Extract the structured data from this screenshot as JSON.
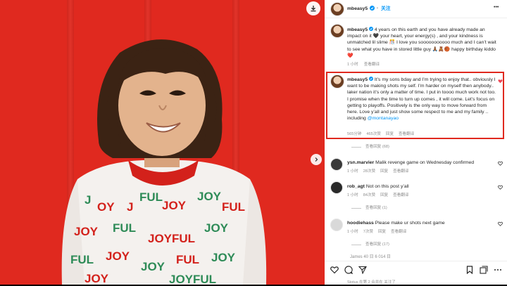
{
  "post": {
    "header": {
      "username": "mbeasy5",
      "follow_label": "关注",
      "more_label": "•••"
    },
    "caption": {
      "username": "mbeasy5",
      "text": "4 years on this earth and you have already made an impact on it 🖤 your heart, your energy(s) , and your kindness is unmatched lil slime 🎊 I love you sooooooooooo much and I can’t wait to see what you have in stored little guy 🙏🏾🧸🏀 happy birthday kiddo ❤️",
      "time": "1 小时",
      "translate_label": "查看翻译"
    },
    "highlight_comment": {
      "username": "mbeasy5",
      "text_main": "It’s my sons bday and I’m trying to enjoy that.. obviously I want to be making shots my self. I’m harder on myself then anybody.. laker nation it’s only a matter of time. I put in toooo much work not too. I promise when the time to turn up comes , it will come. Let’s focus on getting to playoffs. Positively is the only way to move forward from here. Love y’all and just show some respect to me and my family .. including ",
      "mention": "@montanayao",
      "time": "565分钟",
      "likes": "465次赞",
      "reply_label": "回复",
      "translate_label": "查看翻译",
      "view_replies": "查看回复 (68)"
    },
    "comments": [
      {
        "username": "ysn.marvier",
        "text": "Malik revenge game on Wednesday confirmed",
        "time": "1 小时",
        "likes": "28次赞",
        "reply_label": "回复",
        "translate_label": "查看翻译",
        "view_replies": ""
      },
      {
        "username": "rob_agt",
        "text": "Not on this post y’all",
        "time": "1 小时",
        "likes": "84次赞",
        "reply_label": "回复",
        "translate_label": "查看翻译",
        "view_replies": "查看回复 (1)"
      },
      {
        "username": "hoodiehass",
        "text": "Please make ur shots next game",
        "time": "1 小时",
        "likes": "7次赞",
        "reply_label": "回复",
        "translate_label": "查看翻译",
        "view_replies": "查看回复 (17)"
      }
    ],
    "partial_comment": "James 40 日 6 014 日",
    "bottom_partial": "Stotus 在第 2 合并在 关注了",
    "colors": {
      "background": "#e0291f",
      "accent": "#0095f6",
      "highlight_border": "#e0291f",
      "heart": "#ed4956"
    },
    "icons": [
      "download-icon",
      "chevron-right-icon",
      "verified-badge-icon",
      "heart-icon",
      "comment-icon",
      "share-icon",
      "bookmark-icon",
      "more-icon"
    ]
  }
}
